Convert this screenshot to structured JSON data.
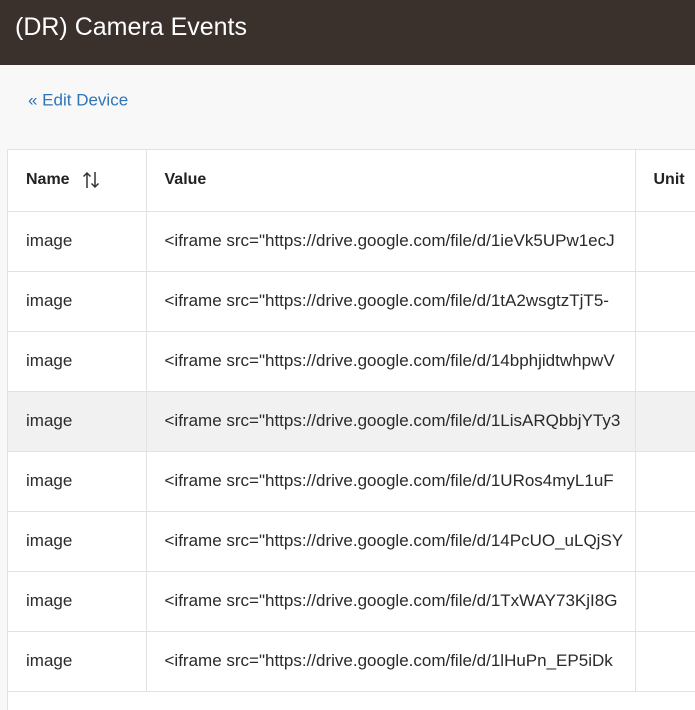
{
  "header": {
    "title": "(DR) Camera Events"
  },
  "nav": {
    "edit_device": "« Edit Device"
  },
  "table": {
    "columns": {
      "name": "Name",
      "value": "Value",
      "unit": "Unit"
    },
    "rows": [
      {
        "name": "image",
        "value": "<iframe src=\"https://drive.google.com/file/d/1ieVk5UPw1ecJ",
        "unit": ""
      },
      {
        "name": "image",
        "value": "<iframe src=\"https://drive.google.com/file/d/1tA2wsgtzTjT5-",
        "unit": ""
      },
      {
        "name": "image",
        "value": "<iframe src=\"https://drive.google.com/file/d/14bphjidtwhpwV",
        "unit": ""
      },
      {
        "name": "image",
        "value": "<iframe src=\"https://drive.google.com/file/d/1LisARQbbjYTy3",
        "unit": ""
      },
      {
        "name": "image",
        "value": "<iframe src=\"https://drive.google.com/file/d/1URos4myL1uF",
        "unit": ""
      },
      {
        "name": "image",
        "value": "<iframe src=\"https://drive.google.com/file/d/14PcUO_uLQjSY",
        "unit": ""
      },
      {
        "name": "image",
        "value": "<iframe src=\"https://drive.google.com/file/d/1TxWAY73KjI8G",
        "unit": ""
      },
      {
        "name": "image",
        "value": "<iframe src=\"https://drive.google.com/file/d/1lHuPn_EP5iDk",
        "unit": ""
      }
    ],
    "highlighted_row": 3
  },
  "colors": {
    "header_bg": "#3a302c",
    "link": "#2f74b5",
    "row_highlight": "#f1f1f1"
  },
  "icons": {
    "sort": "sort-arrows-icon"
  }
}
